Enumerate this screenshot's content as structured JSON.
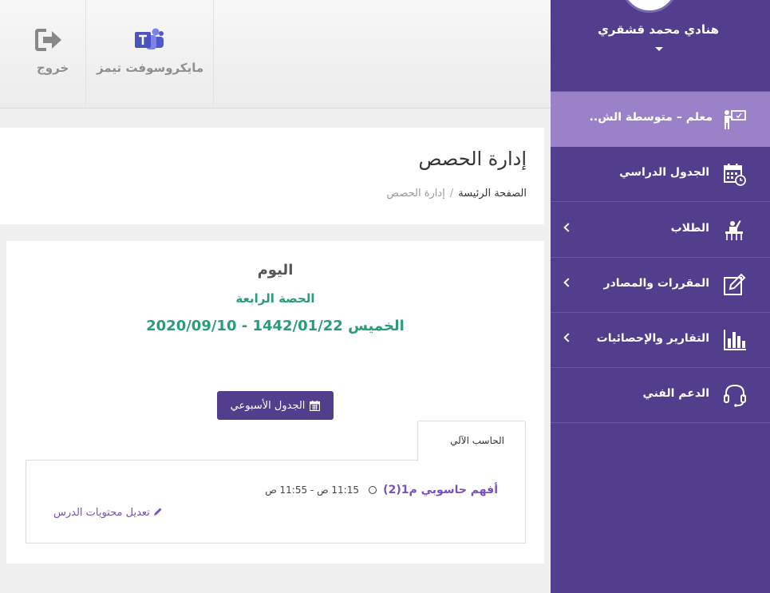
{
  "sidebar": {
    "user_name": "هنادي محمد قشقري",
    "items": [
      {
        "label": "معلم – متوسطة الش..",
        "icon": "teacher-board-icon",
        "active": true
      },
      {
        "label": "الجدول الدراسي",
        "icon": "calendar-clock-icon"
      },
      {
        "label": "الطلاب",
        "icon": "students-icon"
      },
      {
        "label": "المقررات والمصادر",
        "icon": "pencil-square-icon"
      },
      {
        "label": "التقارير والإحصائيات",
        "icon": "bar-chart-icon"
      },
      {
        "label": "الدعم الفني",
        "icon": "headset-icon"
      }
    ]
  },
  "topbar": {
    "teams_label": "مايكروسوفت تيمز",
    "logout_label": "خروج"
  },
  "page": {
    "title": "إدارة الحصص",
    "breadcrumb": {
      "home": "الصفحة الرئيسة",
      "separator": "/",
      "current": "إدارة الحصص"
    }
  },
  "today": {
    "title": "اليوم",
    "period": "الحصة الرابعة",
    "date": "الخميس 1442/01/22 - 2020/09/10"
  },
  "weekly_button": "الجدول الأسبوعي",
  "tab_label": "الحاسب الآلي",
  "lesson": {
    "name": "أفهم حاسوبي م1(2)",
    "time": "11:15 ص - 11:55 ص",
    "edit_label": "تعديل محتويات الدرس"
  },
  "colors": {
    "sidebar": "#523e8c",
    "sidebar_active": "#9b82c8",
    "accent_green": "#2a9d78",
    "accent_purple": "#7b4fbf"
  }
}
